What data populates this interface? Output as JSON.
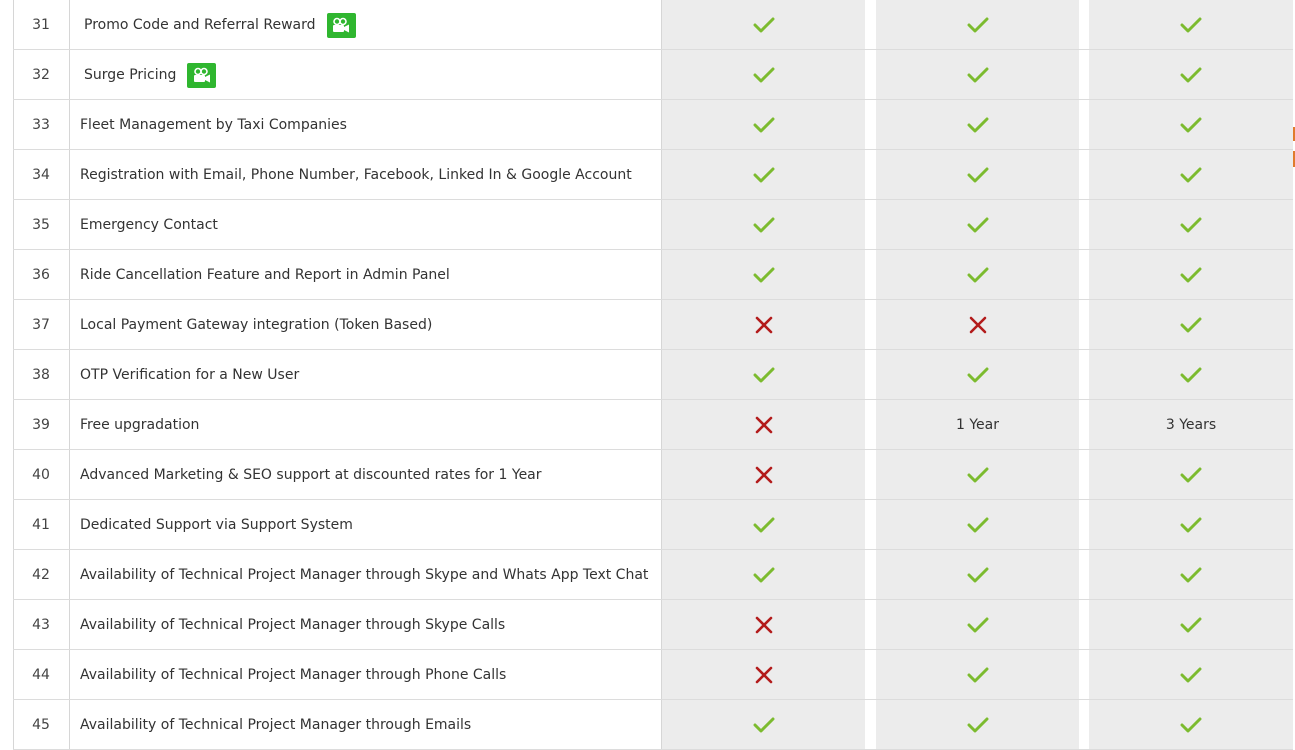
{
  "colors": {
    "check": "#7cbb2f",
    "cross": "#b31b1b",
    "video_badge": "#2fb62f",
    "plan_column_bg": "#ececec"
  },
  "rows": [
    {
      "num": "31",
      "feature": "Promo Code and Referral Reward",
      "video": true,
      "plans": [
        "check",
        "check",
        "check"
      ]
    },
    {
      "num": "32",
      "feature": "Surge Pricing",
      "video": true,
      "plans": [
        "check",
        "check",
        "check"
      ]
    },
    {
      "num": "33",
      "feature": "Fleet Management by Taxi Companies",
      "video": false,
      "plans": [
        "check",
        "check",
        "check"
      ]
    },
    {
      "num": "34",
      "feature": "Registration with Email, Phone Number, Facebook, Linked In & Google Account",
      "video": false,
      "plans": [
        "check",
        "check",
        "check"
      ]
    },
    {
      "num": "35",
      "feature": "Emergency Contact",
      "video": false,
      "plans": [
        "check",
        "check",
        "check"
      ]
    },
    {
      "num": "36",
      "feature": "Ride Cancellation Feature and Report in Admin Panel",
      "video": false,
      "plans": [
        "check",
        "check",
        "check"
      ]
    },
    {
      "num": "37",
      "feature": "Local Payment Gateway integration (Token Based)",
      "video": false,
      "plans": [
        "cross",
        "cross",
        "check"
      ]
    },
    {
      "num": "38",
      "feature": "OTP Verification for a New User",
      "video": false,
      "plans": [
        "check",
        "check",
        "check"
      ]
    },
    {
      "num": "39",
      "feature": "Free upgradation",
      "video": false,
      "plans": [
        "cross",
        "1 Year",
        "3 Years"
      ]
    },
    {
      "num": "40",
      "feature": "Advanced Marketing & SEO support at discounted rates for 1 Year",
      "video": false,
      "plans": [
        "cross",
        "check",
        "check"
      ]
    },
    {
      "num": "41",
      "feature": "Dedicated Support via Support System",
      "video": false,
      "plans": [
        "check",
        "check",
        "check"
      ]
    },
    {
      "num": "42",
      "feature": "Availability of Technical Project Manager through Skype and Whats App Text Chat",
      "video": false,
      "plans": [
        "check",
        "check",
        "check"
      ]
    },
    {
      "num": "43",
      "feature": "Availability of Technical Project Manager through Skype Calls",
      "video": false,
      "plans": [
        "cross",
        "check",
        "check"
      ]
    },
    {
      "num": "44",
      "feature": "Availability of Technical Project Manager through Phone Calls",
      "video": false,
      "plans": [
        "cross",
        "check",
        "check"
      ]
    },
    {
      "num": "45",
      "feature": "Availability of Technical Project Manager through Emails",
      "video": false,
      "plans": [
        "check",
        "check",
        "check"
      ]
    }
  ]
}
